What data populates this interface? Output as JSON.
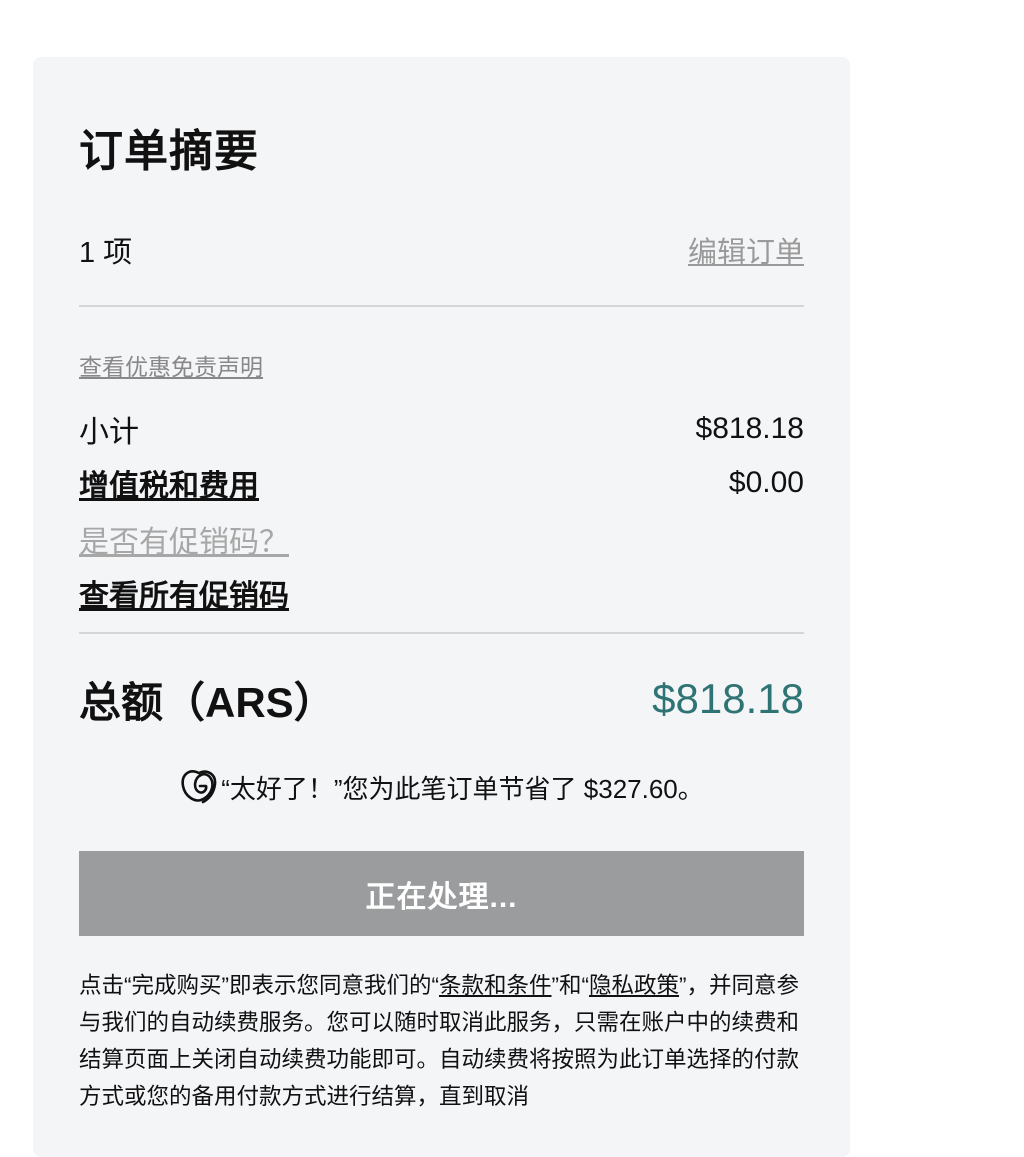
{
  "summary": {
    "title": "订单摘要",
    "item_count": "1 项",
    "edit_order": "编辑订单",
    "offer_disclaimer": "查看优惠免责声明",
    "subtotal_label": "小计",
    "subtotal_value": "$818.18",
    "tax_label": "增值税和费用",
    "tax_value": "$0.00",
    "promo_question": "是否有促销码？",
    "view_all_promos": "查看所有促销码",
    "total_label": "总额（ARS）",
    "total_value": "$818.18",
    "savings_text": "“太好了！”您为此笔订单节省了 $327.60。",
    "processing_button": "正在处理..."
  },
  "legal": {
    "part1": "点击“完成购买”即表示您同意我们的“",
    "terms_link": "条款和条件",
    "part2": "”和“",
    "privacy_link": "隐私政策",
    "part3": "”，并同意参与我们的自动续费服务。您可以随时取消此服务，只需在账户中的续费和结算页面上关闭自动续费功能即可。自动续费将按照为此订单选择的付款方式或您的备用付款方式进行结算，直到取消"
  },
  "colors": {
    "panel_bg": "#f4f5f7",
    "total_accent": "#2e7474",
    "button_disabled": "#9b9c9d"
  },
  "icons": {
    "brand_logo": "godaddy-logo-icon"
  }
}
